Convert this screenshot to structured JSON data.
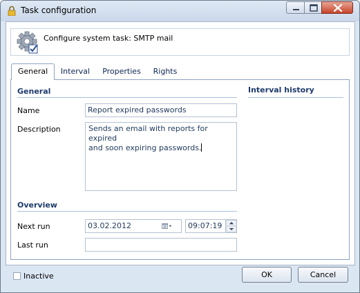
{
  "window": {
    "title": "Task configuration"
  },
  "header": {
    "text": "Configure system task: SMTP mail"
  },
  "tabs": [
    {
      "label": "General",
      "active": true
    },
    {
      "label": "Interval",
      "active": false
    },
    {
      "label": "Properties",
      "active": false
    },
    {
      "label": "Rights",
      "active": false
    }
  ],
  "general": {
    "section_title": "General",
    "name_label": "Name",
    "name_value": "Report expired passwords",
    "description_label": "Description",
    "description_value": "Sends an email with reports for expired\nand soon expiring passwords."
  },
  "interval_history": {
    "title": "Interval history"
  },
  "overview": {
    "section_title": "Overview",
    "next_run_label": "Next run",
    "next_run_date": "03.02.2012",
    "next_run_time": "09:07:19",
    "last_run_label": "Last run",
    "last_run_value": ""
  },
  "footer": {
    "inactive_label": "Inactive",
    "inactive_checked": false,
    "ok_label": "OK",
    "cancel_label": "Cancel"
  },
  "colors": {
    "section_heading": "#1c3a6b",
    "accent_line": "#a8c0dc",
    "window_frame": "#dbe6f3"
  }
}
